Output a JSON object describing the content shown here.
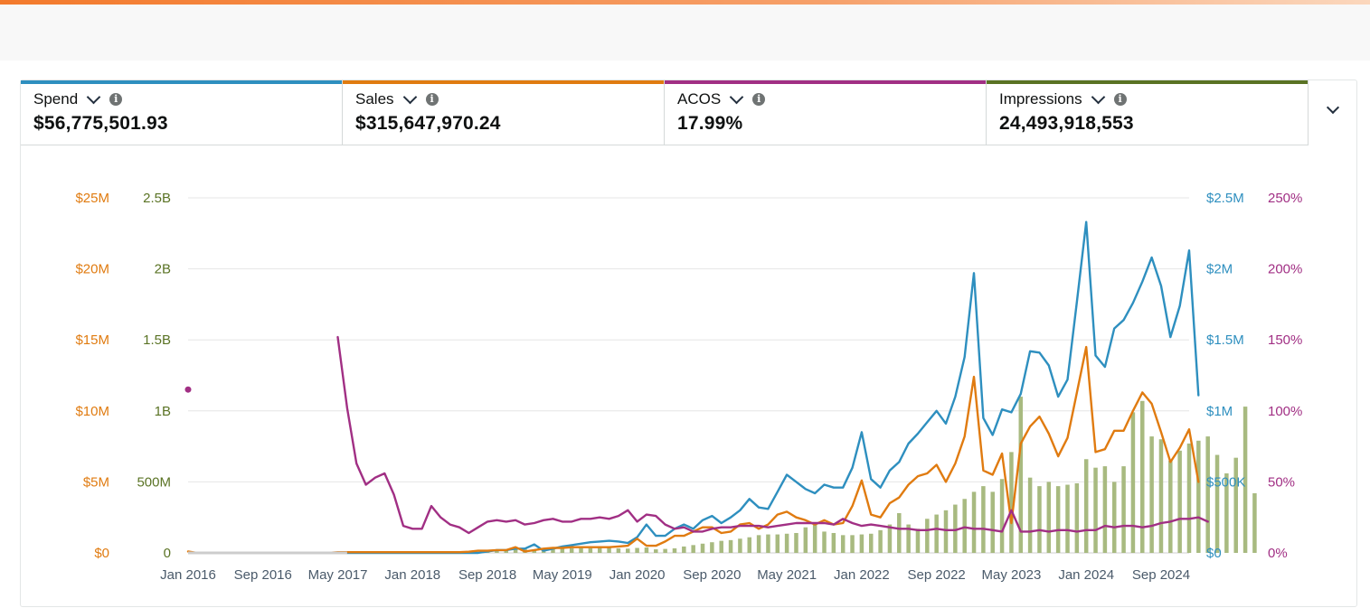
{
  "metrics": [
    {
      "label": "Spend",
      "value": "$56,775,501.93",
      "color": "#2e8fbf"
    },
    {
      "label": "Sales",
      "value": "$315,647,970.24",
      "color": "#e07b10"
    },
    {
      "label": "ACOS",
      "value": "17.99%",
      "color": "#a12f84"
    },
    {
      "label": "Impressions",
      "value": "24,493,918,553",
      "color": "#5a7324"
    }
  ],
  "info_glyph": "i",
  "colors": {
    "spend": "#2e8fbf",
    "sales": "#e07b10",
    "acos": "#a12f84",
    "impressions_bar": "#a8ba80",
    "impressions_axis": "#5a7324",
    "grid": "#e6e6e6",
    "axis_text": "#4a5a6a"
  },
  "chart_data": {
    "type": "line",
    "x": [
      "Jan 2016",
      "Feb 2016",
      "Mar 2016",
      "Apr 2016",
      "May 2016",
      "Jun 2016",
      "Jul 2016",
      "Aug 2016",
      "Sep 2016",
      "Oct 2016",
      "Nov 2016",
      "Dec 2016",
      "Jan 2017",
      "Feb 2017",
      "Mar 2017",
      "Apr 2017",
      "May 2017",
      "Jun 2017",
      "Jul 2017",
      "Aug 2017",
      "Sep 2017",
      "Oct 2017",
      "Nov 2017",
      "Dec 2017",
      "Jan 2018",
      "Feb 2018",
      "Mar 2018",
      "Apr 2018",
      "May 2018",
      "Jun 2018",
      "Jul 2018",
      "Aug 2018",
      "Sep 2018",
      "Oct 2018",
      "Nov 2018",
      "Dec 2018",
      "Jan 2019",
      "Feb 2019",
      "Mar 2019",
      "Apr 2019",
      "May 2019",
      "Jun 2019",
      "Jul 2019",
      "Aug 2019",
      "Sep 2019",
      "Oct 2019",
      "Nov 2019",
      "Dec 2019",
      "Jan 2020",
      "Feb 2020",
      "Mar 2020",
      "Apr 2020",
      "May 2020",
      "Jun 2020",
      "Jul 2020",
      "Aug 2020",
      "Sep 2020",
      "Oct 2020",
      "Nov 2020",
      "Dec 2020",
      "Jan 2021",
      "Feb 2021",
      "Mar 2021",
      "Apr 2021",
      "May 2021",
      "Jun 2021",
      "Jul 2021",
      "Aug 2021",
      "Sep 2021",
      "Oct 2021",
      "Nov 2021",
      "Dec 2021",
      "Jan 2022",
      "Feb 2022",
      "Mar 2022",
      "Apr 2022",
      "May 2022",
      "Jun 2022",
      "Jul 2022",
      "Aug 2022",
      "Sep 2022",
      "Oct 2022",
      "Nov 2022",
      "Dec 2022",
      "Jan 2023",
      "Feb 2023",
      "Mar 2023",
      "Apr 2023",
      "May 2023",
      "Jun 2023",
      "Jul 2023",
      "Aug 2023",
      "Sep 2023",
      "Oct 2023",
      "Nov 2023",
      "Dec 2023",
      "Jan 2024",
      "Feb 2024",
      "Mar 2024",
      "Apr 2024",
      "May 2024",
      "Jun 2024",
      "Jul 2024",
      "Aug 2024",
      "Sep 2024",
      "Oct 2024",
      "Nov 2024",
      "Dec 2024"
    ],
    "x_tick_labels": [
      "Jan 2016",
      "Sep 2016",
      "May 2017",
      "Jan 2018",
      "Sep 2018",
      "May 2019",
      "Jan 2020",
      "Sep 2020",
      "May 2021",
      "Jan 2022",
      "Sep 2022",
      "May 2023",
      "Jan 2024",
      "Sep 2024"
    ],
    "axes": {
      "sales": {
        "ticks": [
          "$0",
          "$5M",
          "$10M",
          "$15M",
          "$20M",
          "$25M"
        ],
        "ylim": [
          0,
          25000000
        ]
      },
      "impressions": {
        "ticks": [
          "0",
          "500M",
          "1B",
          "1.5B",
          "2B",
          "2.5B"
        ],
        "ylim": [
          0,
          2500000000
        ]
      },
      "spend": {
        "ticks": [
          "$0",
          "$500K",
          "$1M",
          "$1.5M",
          "$2M",
          "$2.5M"
        ],
        "ylim": [
          0,
          2500000
        ]
      },
      "acos": {
        "ticks": [
          "0%",
          "50%",
          "100%",
          "150%",
          "200%",
          "250%"
        ],
        "ylim": [
          0,
          250
        ]
      }
    },
    "series": [
      {
        "name": "Impressions",
        "type": "bar",
        "axis": "impressions",
        "values": [
          null,
          0,
          0,
          0,
          0,
          0,
          0,
          0,
          0,
          0,
          0,
          0,
          0,
          0,
          0,
          0,
          4,
          3,
          3,
          3,
          3,
          3,
          3,
          3,
          3,
          3,
          3,
          3,
          3,
          3,
          5,
          8,
          15,
          18,
          22,
          25,
          35,
          20,
          25,
          28,
          30,
          32,
          34,
          33,
          34,
          35,
          32,
          30,
          35,
          38,
          25,
          28,
          32,
          45,
          55,
          65,
          75,
          85,
          90,
          100,
          110,
          125,
          130,
          130,
          135,
          140,
          180,
          200,
          150,
          140,
          125,
          125,
          130,
          135,
          160,
          200,
          280,
          200,
          170,
          240,
          270,
          300,
          340,
          380,
          430,
          470,
          430,
          520,
          710,
          1100,
          530,
          470,
          500,
          470,
          480,
          490,
          660,
          600,
          610,
          500,
          610,
          990,
          1070,
          820,
          800,
          650,
          720,
          770,
          790,
          820,
          690,
          560,
          670,
          1030,
          420
        ],
        "impressions_note": "values in millions"
      },
      {
        "name": "Spend",
        "type": "line",
        "axis": "spend",
        "values": [
          null,
          0,
          0,
          0,
          0,
          0,
          0,
          0,
          0,
          0,
          0,
          0,
          0,
          0,
          0,
          0,
          0,
          0,
          0,
          0,
          0,
          0,
          0,
          0,
          0,
          0,
          0,
          0,
          0,
          0,
          0,
          0,
          10000,
          20000,
          20000,
          30000,
          30000,
          60000,
          15000,
          30000,
          45000,
          55000,
          65000,
          75000,
          80000,
          85000,
          80000,
          70000,
          110000,
          200000,
          120000,
          120000,
          170000,
          200000,
          170000,
          230000,
          260000,
          210000,
          250000,
          300000,
          380000,
          320000,
          310000,
          430000,
          550000,
          500000,
          450000,
          420000,
          480000,
          460000,
          460000,
          600000,
          850000,
          520000,
          460000,
          580000,
          640000,
          770000,
          840000,
          920000,
          1000000,
          910000,
          1100000,
          1380000,
          1970000,
          950000,
          830000,
          1010000,
          990000,
          1120000,
          1420000,
          1410000,
          1320000,
          1100000,
          1220000,
          1770000,
          2330000,
          1390000,
          1310000,
          1580000,
          1640000,
          1760000,
          1910000,
          2080000,
          1880000,
          1520000,
          1740000,
          2130000,
          1110000
        ]
      },
      {
        "name": "Sales",
        "type": "line",
        "axis": "sales",
        "values": [
          100000,
          0,
          0,
          0,
          0,
          0,
          0,
          0,
          0,
          0,
          0,
          0,
          0,
          0,
          0,
          0,
          50000,
          50000,
          50000,
          50000,
          50000,
          50000,
          50000,
          50000,
          50000,
          50000,
          50000,
          50000,
          50000,
          50000,
          80000,
          150000,
          150000,
          200000,
          200000,
          400000,
          100000,
          200000,
          300000,
          350000,
          350000,
          400000,
          400000,
          400000,
          400000,
          400000,
          450000,
          500000,
          1000000,
          500000,
          500000,
          800000,
          1200000,
          1200000,
          1500000,
          1800000,
          1800000,
          1400000,
          1500000,
          2000000,
          2100000,
          1700000,
          2000000,
          2700000,
          2900000,
          2500000,
          2300000,
          2000000,
          2300000,
          2000000,
          2100000,
          3300000,
          5100000,
          2700000,
          2500000,
          3500000,
          3900000,
          4800000,
          5400000,
          5600000,
          6200000,
          5000000,
          6300000,
          8200000,
          12400000,
          5800000,
          5500000,
          7000000,
          2100000,
          7700000,
          8900000,
          9600000,
          8400000,
          6800000,
          8100000,
          11300000,
          14500000,
          7100000,
          7300000,
          8600000,
          8600000,
          10000000,
          11300000,
          10500000,
          8500000,
          6400000,
          7400000,
          8700000,
          5000000
        ]
      },
      {
        "name": "ACOS",
        "type": "line",
        "axis": "acos",
        "values": [
          115,
          null,
          null,
          null,
          null,
          null,
          null,
          null,
          null,
          null,
          null,
          null,
          null,
          null,
          null,
          null,
          152,
          102,
          63,
          48,
          53,
          56,
          41,
          19,
          17,
          17,
          33,
          25,
          20,
          18,
          14,
          18,
          22,
          23,
          22,
          23,
          20,
          21,
          23,
          24,
          22,
          22,
          24,
          24,
          25,
          24,
          26,
          30,
          22,
          27,
          26,
          20,
          17,
          18,
          15,
          15,
          17,
          18,
          18,
          19,
          19,
          19,
          18,
          19,
          20,
          21,
          21,
          21,
          21,
          20,
          24,
          21,
          19,
          20,
          19,
          18,
          17,
          17,
          16,
          16,
          17,
          16,
          16,
          18,
          17,
          17,
          16,
          15,
          30,
          15,
          15,
          16,
          15,
          16,
          16,
          15,
          16,
          16,
          19,
          18,
          19,
          19,
          18,
          19,
          21,
          22,
          24,
          24,
          25,
          22
        ]
      }
    ],
    "grid": true
  }
}
